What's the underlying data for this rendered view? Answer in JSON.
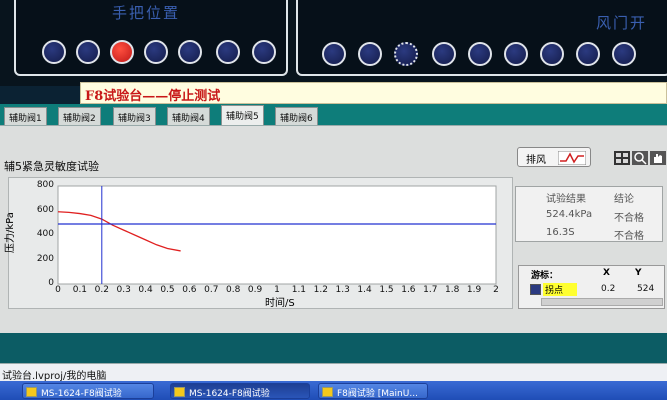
{
  "top": {
    "left_panel_title": "手把位置",
    "right_panel_title": "风门开",
    "left_leds": [
      "off",
      "off",
      "on",
      "off",
      "off",
      "off",
      "off"
    ],
    "right_leds": [
      "off",
      "off",
      "gear",
      "off",
      "off",
      "off",
      "off",
      "off",
      "off"
    ]
  },
  "header": {
    "title": "F8试验台——停止测试"
  },
  "tabs": [
    "辅助阀1",
    "辅助阀2",
    "辅助阀3",
    "辅助阀4",
    "辅助阀5",
    "辅助阀6"
  ],
  "active_tab": "辅助阀5",
  "test": {
    "title": "辅5紧急灵敏度试验",
    "vent_label": "排风"
  },
  "chart_data": {
    "type": "line",
    "ylabel": "压力/kPa",
    "xlabel": "时间/S",
    "xlim": [
      0,
      2
    ],
    "ylim": [
      0,
      800
    ],
    "yticks": [
      "800",
      "600",
      "400",
      "200",
      "0"
    ],
    "xticks": [
      "0",
      "0.1",
      "0.2",
      "0.3",
      "0.4",
      "0.5",
      "0.6",
      "0.7",
      "0.8",
      "0.9",
      "1",
      "1.1",
      "1.2",
      "1.3",
      "1.4",
      "1.5",
      "1.6",
      "1.7",
      "1.8",
      "1.9",
      "2"
    ],
    "series": [
      {
        "color": "#e02020",
        "x": [
          0,
          0.05,
          0.1,
          0.15,
          0.2,
          0.25,
          0.3,
          0.35,
          0.4,
          0.45,
          0.5,
          0.56
        ],
        "y": [
          590,
          585,
          575,
          560,
          530,
          480,
          440,
          400,
          360,
          320,
          290,
          270
        ]
      },
      {
        "color": "#2030d0",
        "x": [
          0,
          2
        ],
        "y": [
          490,
          490
        ]
      }
    ],
    "cursor_x": 0.2
  },
  "results": {
    "header_result": "试验结果",
    "header_verdict": "结论",
    "rows": [
      {
        "value": "524.4kPa",
        "verdict": "不合格"
      },
      {
        "value": "16.3S",
        "verdict": "不合格"
      }
    ]
  },
  "cursor_panel": {
    "label": "游标：",
    "col_x": "X",
    "col_y": "Y",
    "name": "拐点",
    "x": "0.2",
    "y": "524"
  },
  "pathbar": "试验台.lvproj/我的电脑",
  "taskbar": [
    {
      "label": "MS-1624-F8阀试验",
      "active": false
    },
    {
      "label": "MS-1624-F8阀试验",
      "active": true
    },
    {
      "label": "F8阀试验 [MainU...",
      "active": false
    }
  ]
}
